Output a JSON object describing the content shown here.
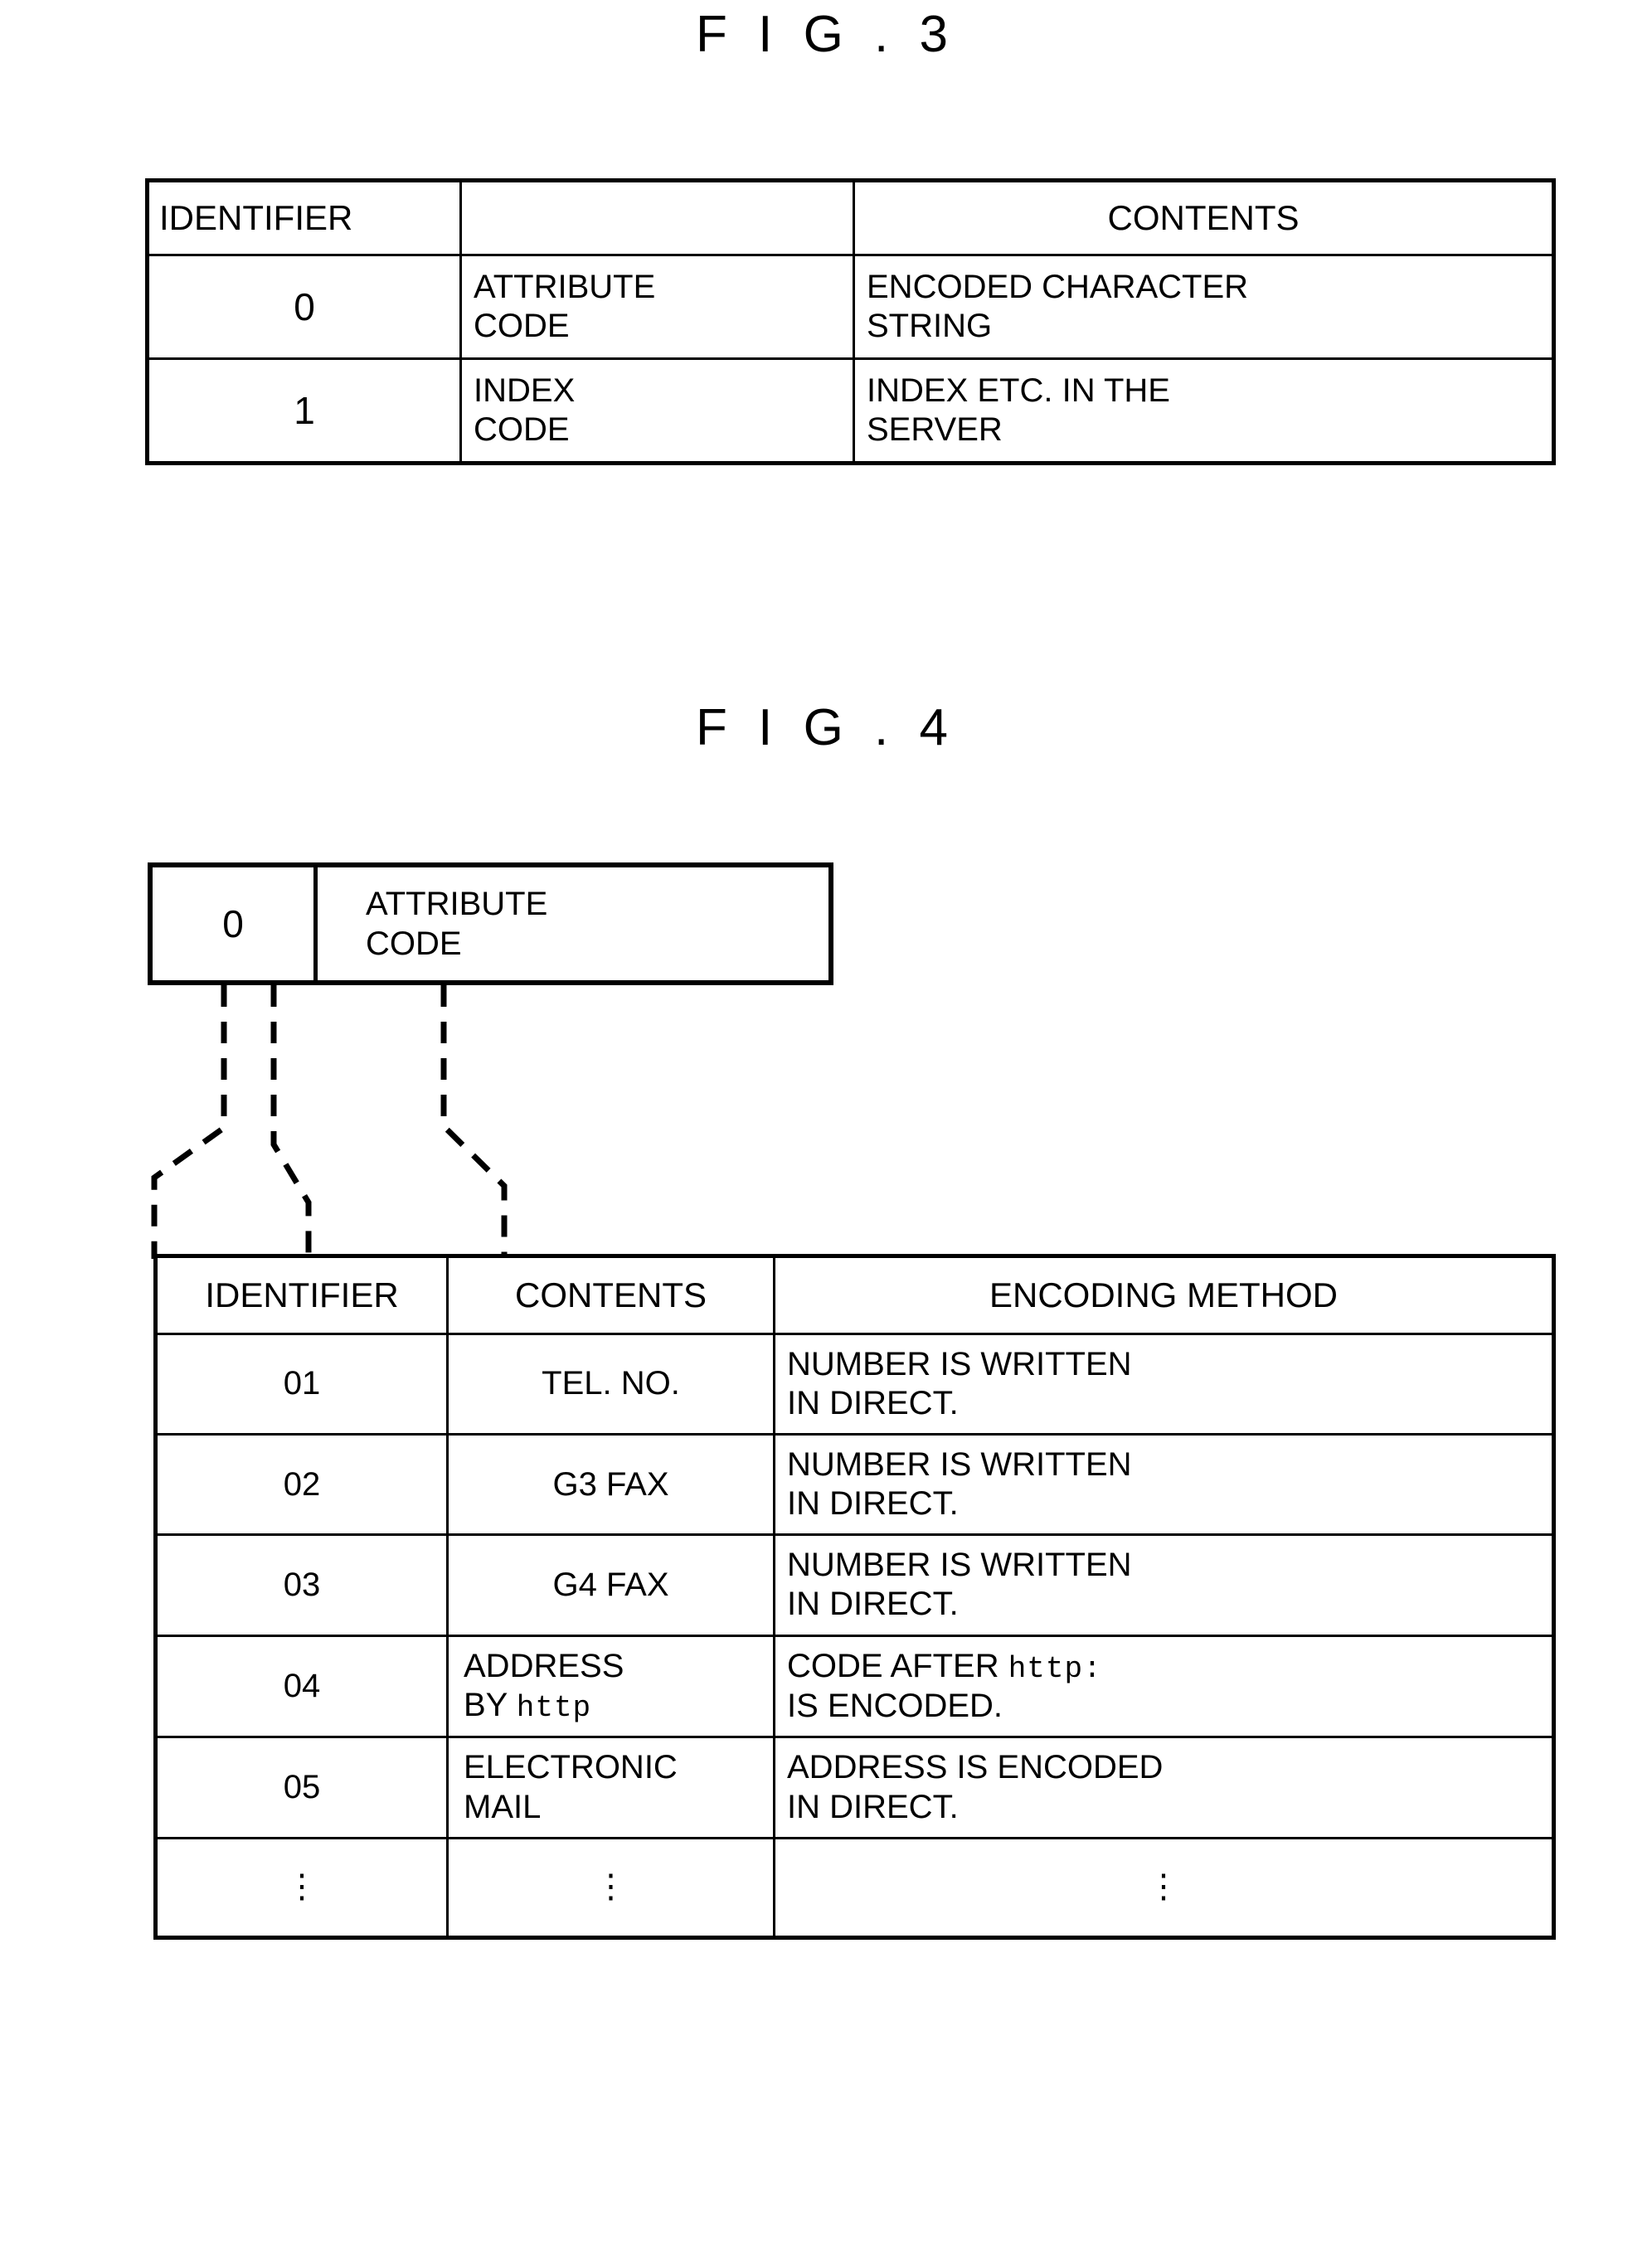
{
  "fig3": {
    "title": "F I G . 3",
    "headers": [
      "IDENTIFIER",
      "",
      "CONTENTS"
    ],
    "rows": [
      {
        "identifier": "0",
        "middle": "ATTRIBUTE\nCODE",
        "contents": "ENCODED CHARACTER\nSTRING"
      },
      {
        "identifier": "1",
        "middle": "INDEX\nCODE",
        "contents": "INDEX ETC. IN THE\nSERVER"
      }
    ]
  },
  "fig4": {
    "title": "F I G . 4",
    "box": {
      "identifier": "0",
      "label": "ATTRIBUTE\nCODE"
    },
    "headers": [
      "IDENTIFIER",
      "CONTENTS",
      "ENCODING METHOD"
    ],
    "rows": [
      {
        "identifier": "01",
        "contents": "TEL. NO.",
        "method": "NUMBER IS  WRITTEN\nIN  DIRECT."
      },
      {
        "identifier": "02",
        "contents": "G3 FAX",
        "method": "NUMBER IS  WRITTEN\nIN  DIRECT."
      },
      {
        "identifier": "03",
        "contents": "G4 FAX",
        "method": "NUMBER IS  WRITTEN\nIN  DIRECT."
      },
      {
        "identifier": "04",
        "contents_pre": "ADDRESS\nBY ",
        "contents_mono": "http",
        "method_pre": "CODE AFTER ",
        "method_mono": "http:",
        "method_post": "\nIS ENCODED."
      },
      {
        "identifier": "05",
        "contents": "ELECTRONIC\nMAIL",
        "method": "ADDRESS IS ENCODED\nIN  DIRECT."
      }
    ],
    "ellipsis": "⋮"
  },
  "colors": {
    "ink": "#000000",
    "paper": "#ffffff"
  }
}
